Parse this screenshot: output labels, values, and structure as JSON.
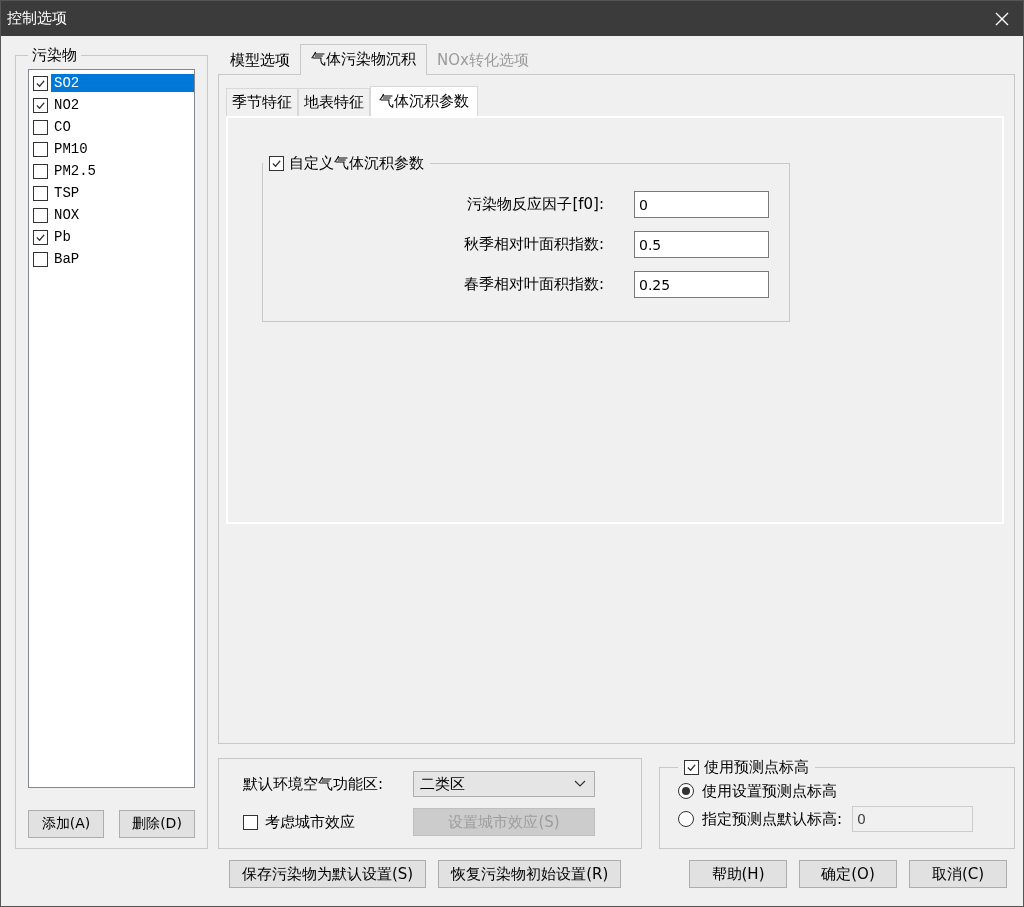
{
  "window": {
    "title": "控制选项"
  },
  "pollutants": {
    "legend": "污染物",
    "items": [
      {
        "label": "SO2",
        "checked": true,
        "selected": true
      },
      {
        "label": "NO2",
        "checked": true,
        "selected": false
      },
      {
        "label": "CO",
        "checked": false,
        "selected": false
      },
      {
        "label": "PM10",
        "checked": false,
        "selected": false
      },
      {
        "label": "PM2.5",
        "checked": false,
        "selected": false
      },
      {
        "label": "TSP",
        "checked": false,
        "selected": false
      },
      {
        "label": "NOX",
        "checked": false,
        "selected": false
      },
      {
        "label": "Pb",
        "checked": true,
        "selected": false
      },
      {
        "label": "BaP",
        "checked": false,
        "selected": false
      }
    ],
    "buttons": [
      "添加(A)",
      "删除(D)"
    ]
  },
  "tabs": [
    {
      "label": "模型选项",
      "selected": false,
      "disabled": false
    },
    {
      "label": "气体污染物沉积",
      "selected": true,
      "disabled": false
    },
    {
      "label": "NOx转化选项",
      "selected": false,
      "disabled": true
    }
  ],
  "subtabs": [
    {
      "label": "季节特征",
      "selected": false
    },
    {
      "label": "地表特征",
      "selected": false
    },
    {
      "label": "气体沉积参数",
      "selected": true
    }
  ],
  "deposition_group": {
    "label": "自定义气体沉积参数",
    "checked": true,
    "fields": [
      {
        "label": "污染物反应因子[f0]:",
        "value": "0"
      },
      {
        "label": "秋季相对叶面积指数:",
        "value": "0.5"
      },
      {
        "label": "春季相对叶面积指数:",
        "value": "0.25"
      }
    ]
  },
  "air_zone": {
    "label": "默认环境空气功能区:",
    "value": "二类区"
  },
  "urban_effect": {
    "label": "考虑城市效应",
    "checked": false,
    "button": {
      "label": "设置城市效应(S)",
      "disabled": true
    }
  },
  "elevation": {
    "label": "使用预测点标高",
    "checked": true,
    "options": [
      {
        "label": "使用设置预测点标高",
        "selected": true
      },
      {
        "label": "指定预测点默认标高:",
        "selected": false
      }
    ],
    "value": "0"
  },
  "footer_left": [
    "保存污染物为默认设置(S)",
    "恢复污染物初始设置(R)"
  ],
  "footer_right": [
    "帮助(H)",
    "确定(O)",
    "取消(C)"
  ]
}
